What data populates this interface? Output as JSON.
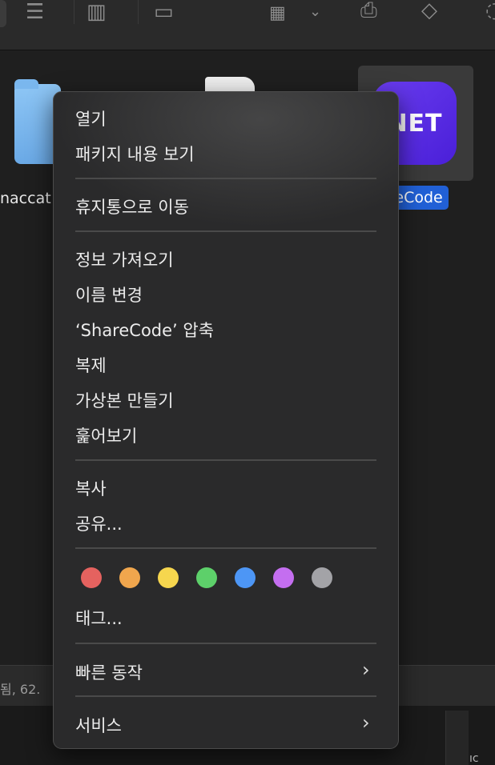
{
  "files": {
    "left_label": "naccat",
    "selected_icon_text": "NET",
    "selected_label": "reCode"
  },
  "status": {
    "text": "됨, 62.",
    "bottom_text": "ıc"
  },
  "context_menu": {
    "open": "열기",
    "show_package_contents": "패키지 내용 보기",
    "move_to_trash": "휴지통으로 이동",
    "get_info": "정보 가져오기",
    "rename": "이름 변경",
    "compress": "‘ShareCode’ 압축",
    "duplicate": "복제",
    "make_alias": "가상본 만들기",
    "quick_look": "훑어보기",
    "copy": "복사",
    "share": "공유...",
    "tags": "태그...",
    "quick_actions": "빠른 동작",
    "services": "서비스",
    "tag_colors": [
      "#e5625f",
      "#f0a64d",
      "#f6d64e",
      "#5dd06a",
      "#4d96f5",
      "#c46ef0",
      "#a3a3a7"
    ]
  }
}
